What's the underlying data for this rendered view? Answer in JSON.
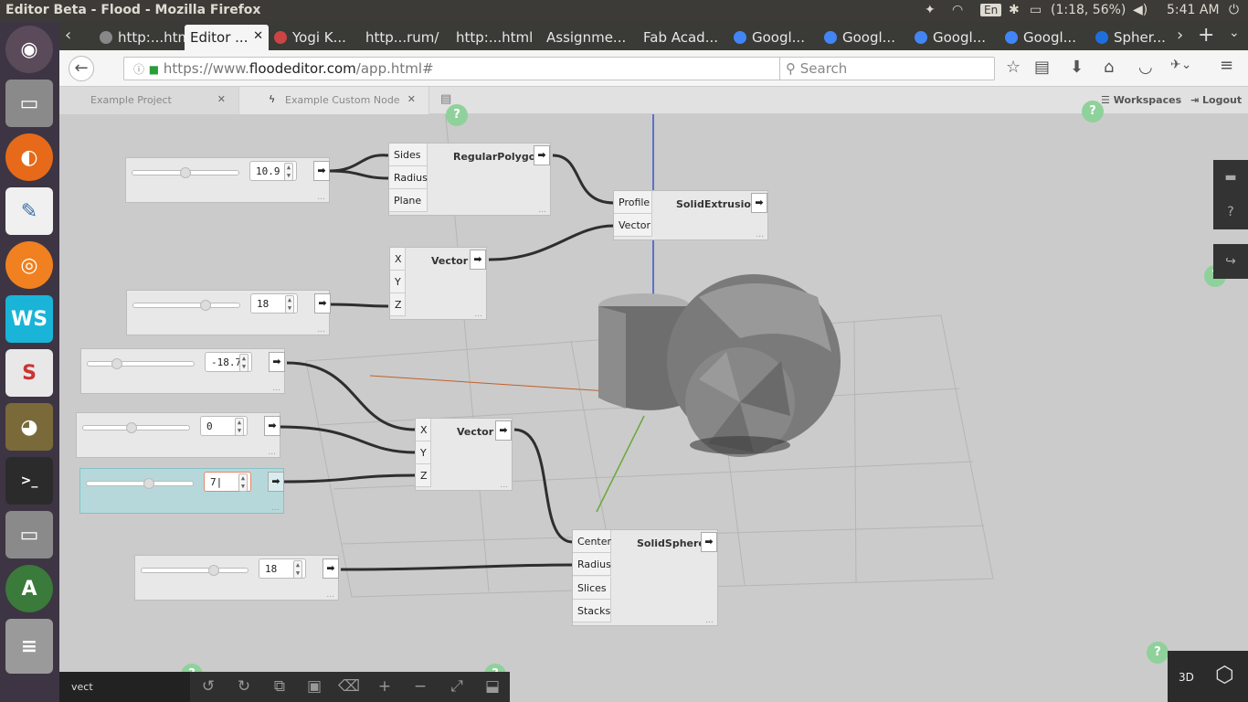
{
  "os": {
    "window_title": "Editor Beta - Flood - Mozilla Firefox",
    "battery": "(1:18, 56%)",
    "time": "5:41 AM",
    "keyboard": "En"
  },
  "browser": {
    "tabs": [
      {
        "label": "http:...html",
        "fav": "#888"
      },
      {
        "label": "Editor ...",
        "fav": "",
        "active": true
      },
      {
        "label": "Yogi K...",
        "fav": "#c44"
      },
      {
        "label": "http...rum/",
        "fav": ""
      },
      {
        "label": "http:...html",
        "fav": ""
      },
      {
        "label": "Assignme...",
        "fav": ""
      },
      {
        "label": "Fab Acad...",
        "fav": ""
      },
      {
        "label": "Googl...",
        "fav": "#4285f4"
      },
      {
        "label": "Googl...",
        "fav": "#4285f4"
      },
      {
        "label": "Googl...",
        "fav": "#4285f4"
      },
      {
        "label": "Googl...",
        "fav": "#4285f4"
      },
      {
        "label": "Spher...",
        "fav": "#1e6fd9"
      }
    ],
    "url_prefix": "https://www.",
    "url_host": "floodeditor.com",
    "url_path": "/app.html#",
    "search_placeholder": "Search"
  },
  "app": {
    "workspace_tabs": [
      "Example Project",
      "Example Custom Node"
    ],
    "workspaces_label": "Workspaces",
    "logout_label": "Logout",
    "help_glyph": "?",
    "arrow_glyph": "➡",
    "dots": "...",
    "sliders": [
      {
        "value": "10.9",
        "level": 0.5
      },
      {
        "value": "18",
        "level": 0.7
      },
      {
        "value": "-18.7",
        "level": 0.25
      },
      {
        "value": "0",
        "level": 0.45
      },
      {
        "value": "7",
        "level": 0.6,
        "selected": true
      },
      {
        "value": "18",
        "level": 0.7
      }
    ],
    "nodes": {
      "polygon": {
        "title": "RegularPolygon",
        "ports": [
          "Sides",
          "Radius",
          "Plane"
        ]
      },
      "extrusion": {
        "title": "SolidExtrusion",
        "ports": [
          "Profile",
          "Vector"
        ]
      },
      "vector1": {
        "title": "Vector",
        "ports": [
          "X",
          "Y",
          "Z"
        ]
      },
      "vector2": {
        "title": "Vector",
        "ports": [
          "X",
          "Y",
          "Z"
        ]
      },
      "sphere": {
        "title": "SolidSphere",
        "ports": [
          "Center",
          "Radius",
          "Slices",
          "Stacks"
        ]
      }
    },
    "search_value": "vect",
    "view_mode": "3D"
  }
}
